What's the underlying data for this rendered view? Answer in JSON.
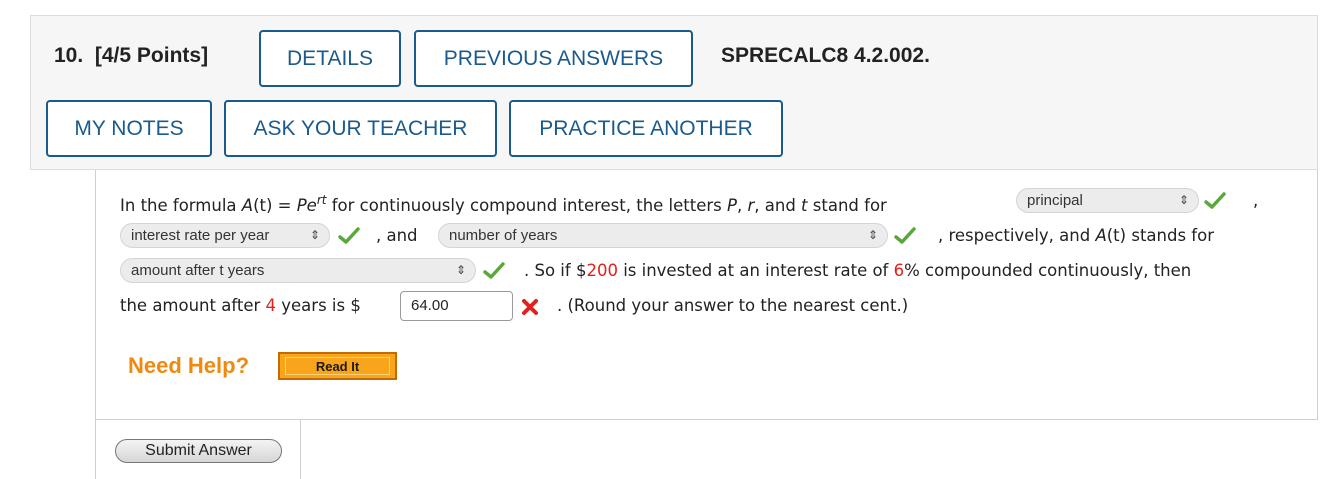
{
  "header": {
    "question_number": "10.",
    "points": "[4/5 Points]",
    "buttons": {
      "details": "DETAILS",
      "previous_answers": "PREVIOUS ANSWERS",
      "my_notes": "MY NOTES",
      "ask_teacher": "ASK YOUR TEACHER",
      "practice_another": "PRACTICE ANOTHER"
    },
    "course_code": "SPRECALC8 4.2.002."
  },
  "question": {
    "t1": "In the formula ",
    "formula_a": "A",
    "formula_t": "(t) = ",
    "formula_p": "Pe",
    "formula_exp": "rt",
    "t2": " for continuously compound interest, the letters ",
    "var_p": "P",
    "comma1": ", ",
    "var_r": "r",
    "and1": ", and ",
    "var_t": "t",
    "t3": " stand for",
    "comma_after1": ",",
    "and2": ", and",
    "t4": ", respectively, and ",
    "at": "A",
    "at2": "(t)",
    "t5": " stands for",
    "t6": ". So if $",
    "principal_value": "200",
    "t7": " is invested at an interest rate of ",
    "rate_value": "6",
    "t8": "% compounded continuously, then",
    "t9": "the amount after ",
    "years_value": "4",
    "t10": " years is $",
    "t11": ". (Round your answer to the nearest cent.)"
  },
  "answers": {
    "select1": {
      "value": "principal",
      "status": "correct"
    },
    "select2": {
      "value": "interest rate per year",
      "status": "correct"
    },
    "select3": {
      "value": "number of years",
      "status": "correct"
    },
    "select4": {
      "value": "amount after t years",
      "status": "correct"
    },
    "input1": {
      "value": "64.00",
      "status": "incorrect"
    }
  },
  "help": {
    "need_help": "Need Help?",
    "read_it": "Read It"
  },
  "submit_label": "Submit Answer",
  "colors": {
    "accent": "#1b5a8c",
    "correct": "#5aa83c",
    "incorrect": "#e3211c",
    "given_values": "#e3211c",
    "help": "#ef8a10"
  }
}
